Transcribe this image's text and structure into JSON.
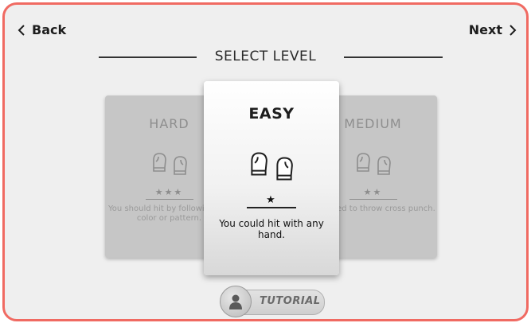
{
  "nav": {
    "back_label": "Back",
    "next_label": "Next"
  },
  "title": "SELECT LEVEL",
  "cards": {
    "hard": {
      "name": "HARD",
      "stars": "★★★",
      "desc": "You should hit by following the color or pattern."
    },
    "easy": {
      "name": "EASY",
      "stars": "★",
      "desc": "You could hit with any hand."
    },
    "medium": {
      "name": "MEDIUM",
      "stars": "★★",
      "desc": "You need to throw cross punch."
    }
  },
  "tutorial": {
    "label": "TUTORIAL"
  },
  "colors": {
    "frame_border": "#f06a62",
    "background": "#efefef",
    "side_card": "#c6c6c6"
  },
  "icons": [
    "chevron-left-icon",
    "chevron-right-icon",
    "boxing-glove-icon",
    "person-icon"
  ]
}
